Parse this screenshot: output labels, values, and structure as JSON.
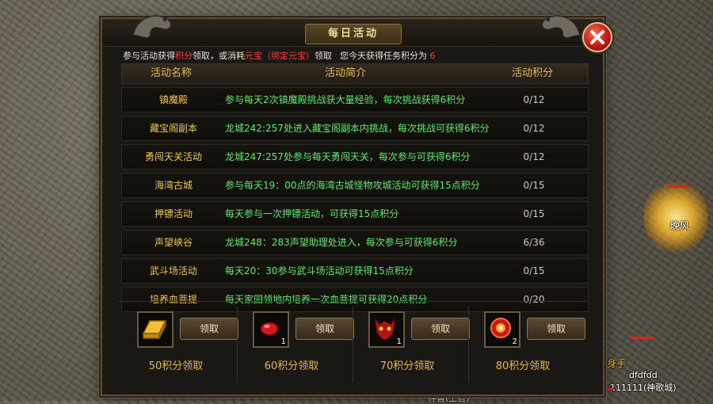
{
  "window": {
    "title": "每日活动",
    "close_label": "close"
  },
  "intro": {
    "p1": "参与活动获得",
    "points_word": "积分",
    "p2": "领取，或消耗",
    "yuanbao": "元宝（绑定元宝）",
    "p3": "领取",
    "p4": "您今天获得任务积分为",
    "today_points": "6"
  },
  "table": {
    "headers": [
      "活动名称",
      "活动简介",
      "活动积分"
    ],
    "rows": [
      {
        "name": "镇魔殿",
        "desc": "参与每天2次镇魔殿挑战获大量经验，每次挑战获得6积分",
        "score": "0/12"
      },
      {
        "name": "藏宝阁副本",
        "desc": "龙城242:257处进入藏宝阁副本内挑战，每次挑战可获得6积分",
        "score": "0/12"
      },
      {
        "name": "勇闯天关活动",
        "desc": "龙城247:257处参与每天勇闯天关，每次参与可获得6积分",
        "score": "0/12"
      },
      {
        "name": "海湾古城",
        "desc": "参与每天19：00点的海湾古城怪物攻城活动可获得15点积分",
        "score": "0/15"
      },
      {
        "name": "押镖活动",
        "desc": "每天参与一次押镖活动，可获得15点积分",
        "score": "0/15"
      },
      {
        "name": "声望峡谷",
        "desc": "龙城248：283声望助理处进入，每次参与可获得6积分",
        "score": "6/36"
      },
      {
        "name": "武斗场活动",
        "desc": "每天20：30参与武斗场活动可获得15点积分",
        "score": "0/15"
      },
      {
        "name": "培养血菩提",
        "desc": "每天家园领地内培养一次血菩提可获得20点积分",
        "score": "0/20"
      }
    ]
  },
  "rewards": [
    {
      "icon": "gold-bar-icon",
      "count": "",
      "button": "领取",
      "points_label": "50积分领取"
    },
    {
      "icon": "red-gem-icon",
      "count": "1",
      "button": "领取",
      "points_label": "60积分领取"
    },
    {
      "icon": "demon-mask-icon",
      "count": "1",
      "button": "领取",
      "points_label": "70积分领取"
    },
    {
      "icon": "fire-orb-icon",
      "count": "2",
      "button": "领取",
      "points_label": "80积分领取"
    }
  ],
  "scene": {
    "player_right_name": "晚风",
    "player_bottom_name": "神兽(上官)",
    "npc_name": "dfdfdd",
    "npc_guild": "111111(神歌城)",
    "npc_title_char": "身手"
  },
  "colors": {
    "accent_gold": "#e7b93d",
    "desc_green": "#5fe86a",
    "highlight_red": "#ff3b2f"
  }
}
